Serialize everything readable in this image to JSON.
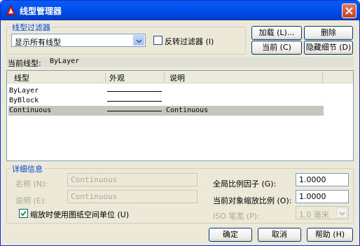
{
  "window": {
    "title": "线型管理器"
  },
  "filter": {
    "group_label": "线型过滤器",
    "selected": "显示所有线型",
    "invert_label": "反转过滤器 (I)",
    "invert_checked": false
  },
  "buttons": {
    "load": "加载 (L)...",
    "delete": "删除",
    "current": "当前 (C)",
    "hide_details": "隐藏细节 (D)",
    "ok": "确定",
    "cancel": "取消",
    "help": "帮助 (H)"
  },
  "current_linetype": {
    "label": "当前线型:",
    "value": "ByLayer"
  },
  "list": {
    "columns": [
      "线型",
      "外观",
      "说明"
    ],
    "rows": [
      {
        "name": "ByLayer",
        "description": "",
        "selected": false
      },
      {
        "name": "ByBlock",
        "description": "",
        "selected": false
      },
      {
        "name": "Continuous",
        "description": "Continuous",
        "selected": true
      }
    ]
  },
  "details": {
    "group_label": "详细信息",
    "name_label": "名称 (N):",
    "name_value": "Continuous",
    "desc_label": "说明 (E):",
    "desc_value": "Continuous",
    "paperspace_label": "缩放时使用图纸空间单位 (U)",
    "paperspace_checked": true,
    "global_scale_label": "全局比例因子 (G):",
    "global_scale_value": "1.0000",
    "object_scale_label": "当前对象缩放比例 (O):",
    "object_scale_value": "1.0000",
    "iso_pen_label": "ISO 笔宽 (P):",
    "iso_pen_value": "1.0 毫米"
  },
  "colors": {
    "titlebar": "#0054e3",
    "accent": "#0046d5",
    "selected_row": "#c7c6be"
  }
}
